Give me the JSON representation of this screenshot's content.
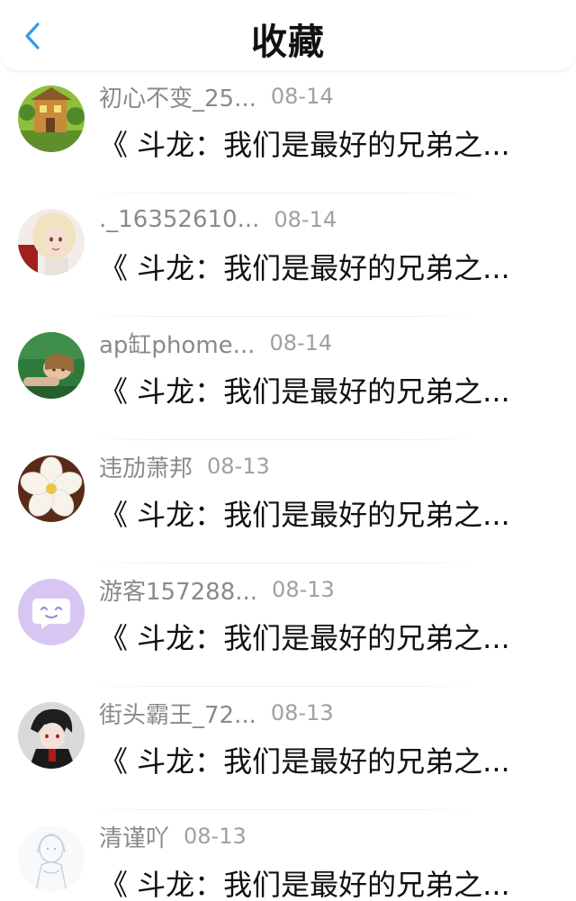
{
  "header": {
    "title": "收藏",
    "back_icon": "chevron-left-icon",
    "accent": "#2f9bf0"
  },
  "items": [
    {
      "name": "初心不变_25...",
      "date": "08-14",
      "title": "《 斗龙：我们是最好的兄弟之...",
      "avatar": "treehouse-avatar"
    },
    {
      "name": "._16352610...",
      "date": "08-14",
      "title": "《 斗龙：我们是最好的兄弟之...",
      "avatar": "anime-girl-avatar"
    },
    {
      "name": "ap缸phome...",
      "date": "08-14",
      "title": "《 斗龙：我们是最好的兄弟之...",
      "avatar": "girl-on-grass-avatar"
    },
    {
      "name": "违劢萧邦",
      "date": "08-13",
      "title": "《 斗龙：我们是最好的兄弟之...",
      "avatar": "white-flower-avatar"
    },
    {
      "name": "游客157288...",
      "date": "08-13",
      "title": "《 斗龙：我们是最好的兄弟之...",
      "avatar": "default-chat-avatar"
    },
    {
      "name": "街头霸王_72...",
      "date": "08-13",
      "title": "《 斗龙：我们是最好的兄弟之...",
      "avatar": "anime-boy-avatar"
    },
    {
      "name": "清谨吖",
      "date": "08-13",
      "title": "《 斗龙：我们是最好的兄弟之...",
      "avatar": "white-sketch-avatar"
    }
  ]
}
